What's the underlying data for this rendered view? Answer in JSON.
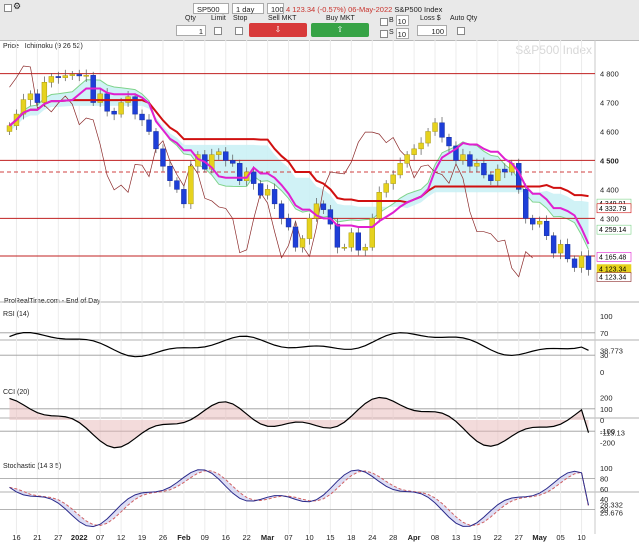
{
  "toolbar": {
    "qty_label": "Qty",
    "qty_value": "1",
    "limit_label": "Limit",
    "stop_label": "Stop",
    "sell_label": "Sell MKT",
    "buy_label": "Buy MKT",
    "loss_label": "Loss $",
    "loss_value": "100",
    "auto_qty_label": "Auto Qty",
    "symbol": "SP500",
    "interval": "1 day",
    "units": "100 units",
    "quote": "4 123.34 (-0.57%) 06-May-2022",
    "symbol_name": "S&P500 Index",
    "buy_checkbox_label": "B",
    "sell_checkbox_label": "S",
    "qty_spin_1": "10",
    "qty_spin_2": "10"
  },
  "chart_data": [
    {
      "type": "candlestick",
      "title": "S&P500 Index",
      "legend": [
        "Price",
        "Ichimoku (9 26 52)"
      ],
      "footer": "ProRealTime.com - End of Day",
      "x_tick_labels": [
        "16",
        "21",
        "27",
        "2022",
        "07",
        "12",
        "19",
        "26",
        "Feb",
        "09",
        "16",
        "22",
        "Mar",
        "07",
        "10",
        "15",
        "18",
        "24",
        "28",
        "Apr",
        "08",
        "13",
        "19",
        "22",
        "27",
        "May",
        "05",
        "10"
      ],
      "y_ticks": [
        4300,
        4400,
        4500,
        4600,
        4700,
        4800
      ],
      "ylim": [
        4080,
        4840
      ],
      "series_close": [
        4620,
        4660,
        4710,
        4730,
        4700,
        4770,
        4790,
        4786,
        4793,
        4797,
        4792,
        4794,
        4700,
        4730,
        4670,
        4660,
        4700,
        4720,
        4660,
        4640,
        4600,
        4540,
        4480,
        4430,
        4400,
        4350,
        4480,
        4520,
        4470,
        4520,
        4530,
        4500,
        4490,
        4430,
        4460,
        4420,
        4380,
        4400,
        4350,
        4300,
        4270,
        4200,
        4230,
        4300,
        4350,
        4330,
        4280,
        4200,
        4200,
        4250,
        4190,
        4200,
        4300,
        4390,
        4420,
        4450,
        4490,
        4520,
        4540,
        4560,
        4600,
        4630,
        4580,
        4550,
        4500,
        4520,
        4480,
        4490,
        4450,
        4430,
        4470,
        4460,
        4490,
        4400,
        4300,
        4280,
        4290,
        4240,
        4180,
        4210,
        4160,
        4130,
        4170,
        4123
      ],
      "price_labels": [
        "4 349.01",
        "4 332.79",
        "4 259.14",
        "4 165.48",
        "4 123.34",
        "4 123.34"
      ],
      "last_price": "4 123.34",
      "horizontal_lines": [
        4800,
        4500,
        4300,
        4170
      ],
      "dashed_line": 4460
    },
    {
      "type": "line",
      "title": "RSI (14)",
      "y_ticks": [
        100,
        70,
        30,
        0
      ],
      "ylim": [
        0,
        100
      ],
      "last_value": "38.773"
    },
    {
      "type": "line",
      "title": "CCI (20)",
      "y_ticks": [
        200,
        100,
        0,
        -100,
        -200
      ],
      "ylim": [
        -250,
        250
      ],
      "last_value": "-113.13"
    },
    {
      "type": "line",
      "title": "Stochastic (14 3 5)",
      "y_ticks": [
        100,
        80,
        60,
        40,
        20
      ],
      "ylim": [
        0,
        100
      ],
      "last_values": [
        "28.332",
        "25.676"
      ]
    }
  ]
}
